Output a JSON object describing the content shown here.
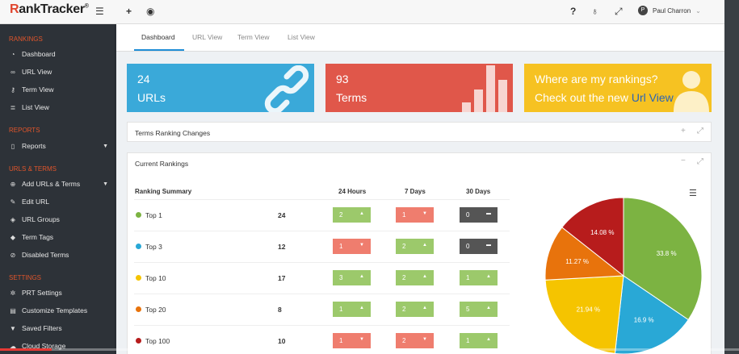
{
  "app": {
    "logo_prefix": "R",
    "logo_main": "ankTracker",
    "logo_mark": "®"
  },
  "topbar": {
    "help_icon": "?",
    "bulb_icon": "💡",
    "expand_icon": "⤢",
    "user_initial": "P",
    "user_name": "Paul Charron",
    "user_caret": "⌄"
  },
  "sidebar": {
    "sections": [
      {
        "title": "RANKINGS"
      },
      {
        "title": "REPORTS"
      },
      {
        "title": "URLS & TERMS"
      },
      {
        "title": "SETTINGS"
      }
    ],
    "items": [
      {
        "label": "Dashboard",
        "icon": "dashboard-icon"
      },
      {
        "label": "URL View",
        "icon": "link-icon"
      },
      {
        "label": "Term View",
        "icon": "key-icon"
      },
      {
        "label": "List View",
        "icon": "list-icon"
      },
      {
        "label": "Reports",
        "icon": "file-icon"
      },
      {
        "label": "Add URLs & Terms",
        "icon": "plus-icon"
      },
      {
        "label": "Edit URL",
        "icon": "edit-icon"
      },
      {
        "label": "URL Groups",
        "icon": "stack-icon"
      },
      {
        "label": "Term Tags",
        "icon": "tag-icon"
      },
      {
        "label": "Disabled Terms",
        "icon": "ban-icon"
      },
      {
        "label": "PRT Settings",
        "icon": "gear-icon"
      },
      {
        "label": "Customize Templates",
        "icon": "template-icon"
      },
      {
        "label": "Saved Filters",
        "icon": "filter-icon"
      },
      {
        "label": "Cloud Storage",
        "icon": "cloud-icon"
      }
    ]
  },
  "tabs": [
    {
      "label": "Dashboard"
    },
    {
      "label": "URL View"
    },
    {
      "label": "Term View"
    },
    {
      "label": "List View"
    }
  ],
  "stats": {
    "urls_count": "24",
    "urls_label": "URLs",
    "terms_count": "93",
    "terms_label": "Terms",
    "promo_line1": "Where are my rankings?",
    "promo_line2_prefix": "Check out the new ",
    "promo_link": "Url View"
  },
  "panels": {
    "terms_changes_title": "Terms Ranking Changes",
    "current_rankings_title": "Current Rankings"
  },
  "rankings": {
    "headers": {
      "summary": "Ranking Summary",
      "h24": "24 Hours",
      "d7": "7 Days",
      "d30": "30 Days"
    },
    "rows": [
      {
        "name": "Top 1",
        "count": "24",
        "color": "#7cb342",
        "h24": {
          "value": "2",
          "dir": "up"
        },
        "d7": {
          "value": "1",
          "dir": "down"
        },
        "d30": {
          "value": "0",
          "dir": "flat"
        }
      },
      {
        "name": "Top 3",
        "count": "12",
        "color": "#29a8d6",
        "h24": {
          "value": "1",
          "dir": "down"
        },
        "d7": {
          "value": "2",
          "dir": "up"
        },
        "d30": {
          "value": "0",
          "dir": "flat"
        }
      },
      {
        "name": "Top 10",
        "count": "17",
        "color": "#f5c400",
        "h24": {
          "value": "3",
          "dir": "up"
        },
        "d7": {
          "value": "2",
          "dir": "up"
        },
        "d30": {
          "value": "1",
          "dir": "up"
        }
      },
      {
        "name": "Top 20",
        "count": "8",
        "color": "#e8730c",
        "h24": {
          "value": "1",
          "dir": "up"
        },
        "d7": {
          "value": "2",
          "dir": "up"
        },
        "d30": {
          "value": "5",
          "dir": "up"
        }
      },
      {
        "name": "Top 100",
        "count": "10",
        "color": "#b71c1c",
        "h24": {
          "value": "1",
          "dir": "down"
        },
        "d7": {
          "value": "2",
          "dir": "down"
        },
        "d30": {
          "value": "1",
          "dir": "up"
        }
      }
    ]
  },
  "chart_data": {
    "type": "pie",
    "slices": [
      {
        "label": "33.8 %",
        "value": 33.8,
        "color": "#7cb342"
      },
      {
        "label": "16.9 %",
        "value": 16.9,
        "color": "#29a8d6"
      },
      {
        "label": "21.94 %",
        "value": 21.94,
        "color": "#f5c400"
      },
      {
        "label": "11.27 %",
        "value": 11.27,
        "color": "#e8730c"
      },
      {
        "label": "14.08 %",
        "value": 14.08,
        "color": "#b71c1c"
      }
    ]
  },
  "colors": {
    "accent": "#1f8dd6",
    "section": "#e0552b",
    "up": "#9cc96b",
    "down": "#ef7d6e",
    "flat": "#555555"
  },
  "video_progress": 0.07
}
